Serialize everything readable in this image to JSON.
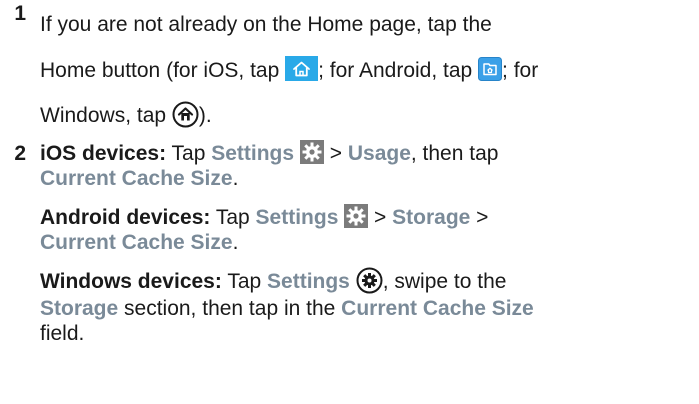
{
  "steps": [
    {
      "number": "1",
      "lines": {
        "l1": "If you are not already on the Home page, tap the",
        "l2_a": "Home button (for iOS, tap ",
        "l2_b": "; for Android, tap ",
        "l2_c": "; for",
        "l3_a": "Windows, tap ",
        "l3_b": ")."
      },
      "icons": {
        "ios": "home-icon",
        "android": "android-home-icon",
        "windows": "windows-home-icon"
      }
    },
    {
      "number": "2",
      "ios": {
        "term": "iOS devices:",
        "tap": " Tap ",
        "settings": "Settings",
        "sep": " > ",
        "usage": "Usage",
        "then": ", then tap",
        "cache": "Current Cache Size",
        "end": "."
      },
      "android": {
        "term": "Android devices:",
        "tap": " Tap ",
        "settings": "Settings",
        "sep1": " > ",
        "storage": "Storage",
        "sep2": " >",
        "cache": "Current Cache Size",
        "end": "."
      },
      "windows": {
        "term": "Windows devices:",
        "tap": " Tap ",
        "settings": "Settings",
        "swipe": ", swipe to the",
        "storage": "Storage",
        "section": " section, then tap in the ",
        "cache": "Current Cache Size",
        "field": "field."
      },
      "icons": {
        "settings": "gear-icon",
        "windows_settings": "windows-settings-icon"
      }
    }
  ],
  "colors": {
    "ui_label": "#7a8a98",
    "ios_icon_bg": "#29a9e8",
    "android_icon_bg": "#3aa0e8",
    "gear_bg": "#7b7b7b"
  }
}
